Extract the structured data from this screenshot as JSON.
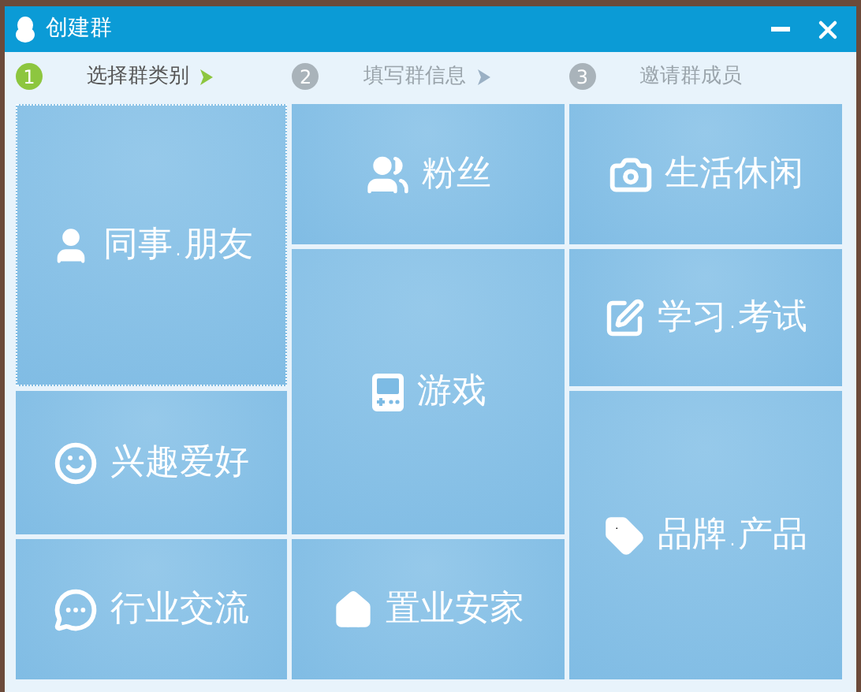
{
  "window": {
    "title": "创建群"
  },
  "steps": [
    {
      "number": "1",
      "label": "选择群类别",
      "selected": true
    },
    {
      "number": "2",
      "label": "填写群信息",
      "selected": false
    },
    {
      "number": "3",
      "label": "邀请群成员",
      "selected": false
    }
  ],
  "tiles": [
    {
      "label": "同事.朋友",
      "kind": "colleague",
      "selected": true
    },
    {
      "label": "粉丝",
      "kind": "fans",
      "selected": false
    },
    {
      "label": "生活休闲",
      "kind": "life",
      "selected": false
    },
    {
      "label": "游戏",
      "kind": "game",
      "selected": false
    },
    {
      "label": "学习.考试",
      "kind": "study",
      "selected": false
    },
    {
      "label": "兴趣爱好",
      "kind": "hobby",
      "selected": false
    },
    {
      "label": "品牌.产品",
      "kind": "brand",
      "selected": false
    },
    {
      "label": "行业交流",
      "kind": "industry",
      "selected": false
    },
    {
      "label": "置业安家",
      "kind": "home",
      "selected": false
    }
  ]
}
